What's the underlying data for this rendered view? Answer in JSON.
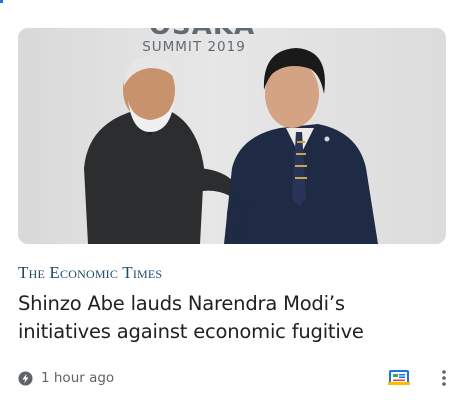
{
  "hero": {
    "backdrop_heading": "OSAKA",
    "backdrop_subheading": "SUMMIT 2019"
  },
  "article": {
    "publisher": "The Economic Times",
    "headline": "Shinzo Abe lauds Narendra Modi’s initiatives against economic fugitive",
    "time_ago": "1 hour ago"
  },
  "icons": {
    "time": "lightning-bolt-icon",
    "full_coverage": "full-coverage-icon",
    "more": "more-vert-icon"
  },
  "colors": {
    "publisher": "#1d4a66",
    "headline": "#202124",
    "meta": "#5f6368",
    "full_coverage_blue": "#1a73e8",
    "full_coverage_yellow": "#fbbc04",
    "full_coverage_red": "#ea4335",
    "full_coverage_green": "#34a853"
  }
}
